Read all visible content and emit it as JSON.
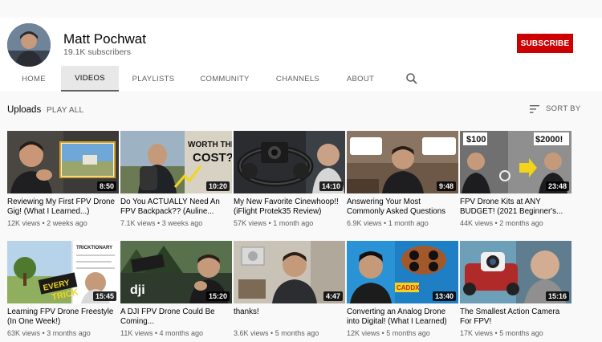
{
  "channel": {
    "name": "Matt Pochwat",
    "subscribers": "19.1K subscribers",
    "subscribe_label": "SUBSCRIBE"
  },
  "tabs": [
    {
      "label": "HOME",
      "active": false
    },
    {
      "label": "VIDEOS",
      "active": true
    },
    {
      "label": "PLAYLISTS",
      "active": false
    },
    {
      "label": "COMMUNITY",
      "active": false
    },
    {
      "label": "CHANNELS",
      "active": false
    },
    {
      "label": "ABOUT",
      "active": false
    }
  ],
  "section": {
    "title": "Uploads",
    "play_all": "PLAY ALL",
    "sort_by": "SORT BY"
  },
  "videos": [
    {
      "title": "Reviewing My First FPV Drone Gig! (What I Learned...)",
      "views": "12K views",
      "age": "2 weeks ago",
      "duration": "8:50",
      "overlay_text": ""
    },
    {
      "title": "Do You ACTUALLY Need An FPV Backpack?? (Auline...",
      "views": "7.1K views",
      "age": "3 weeks ago",
      "duration": "10:20",
      "overlay_text": "WORTH THE COST??"
    },
    {
      "title": "My New Favorite Cinewhoop!! (iFlight Protek35 Review)",
      "views": "57K views",
      "age": "1 month ago",
      "duration": "14:10",
      "overlay_text": ""
    },
    {
      "title": "Answering Your Most Commonly Asked Questions",
      "views": "6.9K views",
      "age": "1 month ago",
      "duration": "9:48",
      "overlay_text": ""
    },
    {
      "title": "FPV Drone Kits at ANY BUDGET! (2021 Beginner's...",
      "views": "44K views",
      "age": "2 months ago",
      "duration": "23:48",
      "overlay_text": "$100  $2000!"
    },
    {
      "title": "Learning FPV Drone Freestyle (In One Week!)",
      "views": "63K views",
      "age": "3 months ago",
      "duration": "15:45",
      "overlay_text": "EVERY TRICK"
    },
    {
      "title": "A DJI FPV Drone Could Be Coming...",
      "views": "11K views",
      "age": "4 months ago",
      "duration": "15:20",
      "overlay_text": "dji"
    },
    {
      "title": "thanks!",
      "views": "3.6K views",
      "age": "5 months ago",
      "duration": "4:47",
      "overlay_text": ""
    },
    {
      "title": "Converting an Analog Drone into Digital! (What I Learned)",
      "views": "12K views",
      "age": "5 months ago",
      "duration": "13:40",
      "overlay_text": "CADDX"
    },
    {
      "title": "The Smallest Action Camera For FPV!",
      "views": "17K views",
      "age": "5 months ago",
      "duration": "15:16",
      "overlay_text": ""
    }
  ],
  "colors": {
    "subscribe_red": "#cc0000",
    "page_bg": "#f9f9f9",
    "header_bg": "#ffffff",
    "active_tab_bg": "#e8e8e8"
  }
}
